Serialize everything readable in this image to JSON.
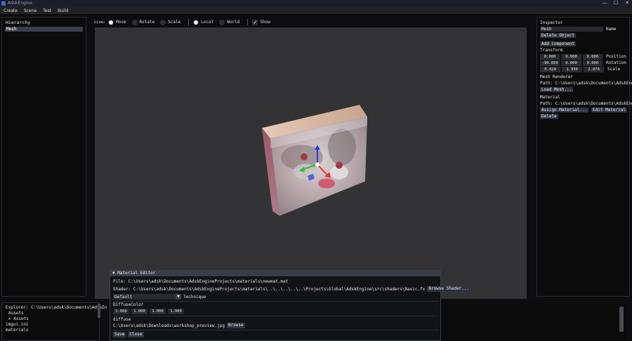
{
  "titlebar": {
    "title": "AdskEngine"
  },
  "window_controls": {
    "minimize": "—",
    "maximize": "☐",
    "close": "✕"
  },
  "menu": {
    "items": [
      "Create",
      "Scene",
      "Test",
      "Build"
    ]
  },
  "hierarchy": {
    "title": "Hierarchy",
    "items": [
      "Mesh"
    ]
  },
  "gizmo": {
    "label": "Gizmo",
    "modes": [
      "Move",
      "Rotate",
      "Scale"
    ],
    "selected_mode": "Move",
    "spaces": [
      "Local",
      "World"
    ],
    "selected_space": "Local",
    "show_label": "Show",
    "show_checked": true
  },
  "inspector": {
    "title": "Inspector",
    "name_value": "Mesh",
    "name_label": "Name",
    "delete_object": "Delete Object",
    "add_component": "Add Component",
    "transform_title": "Transform",
    "position": {
      "values": [
        "0.000",
        "0.000",
        "0.000"
      ],
      "label": "Position"
    },
    "rotation": {
      "values": [
        "-90.000",
        "0.000",
        "0.000"
      ],
      "label": "Rotation"
    },
    "scale": {
      "values": [
        "0.420",
        "1.930",
        "2.070"
      ],
      "label": "Scale"
    },
    "mesh_renderer_title": "Mesh Renderer",
    "mesh_path": "Path: C:\\Users\\adsk\\Documents\\AdskEngin",
    "load_mesh": "Load Mesh...",
    "material_title": "Material",
    "material_path": "Path: C:\\Users\\adsk\\Documents\\AdskEngi",
    "assign_material": "Assign Material...",
    "edit_material": "Edit Material",
    "delete": "Delete"
  },
  "explorer": {
    "path": "Explorer: C:\\Users\\adsk\\Documents\\AdskEn",
    "assets_header": "Assets",
    "assets_folder": "▸ Assets",
    "file1": "imgui.ini",
    "file2": "materials"
  },
  "material_editor": {
    "title": "▼ Material Editor",
    "file": "File: C:\\Users\\adsk\\Documents\\AdskEngineProjects\\materials\\newmat.mat",
    "shader": "Shader: C:\\Users\\adsk\\Documents\\AdskEngineProjects\\materials\\..\\..\\..\\..\\..\\Projects\\Global\\AdskEngine\\src\\shaders\\Basic.fx",
    "browse_shader": "Browse Shader...",
    "technique_value": "Default",
    "technique_label": "Technique",
    "diffuse_color_label": "DiffuseColor",
    "diffuse_color_values": [
      "1.000",
      "1.000",
      "1.000",
      "1.000"
    ],
    "diffuse_label": "diffuse",
    "diffuse_path": "C:\\Users\\adsk\\Downloads\\workshop_preview.jpg",
    "browse": "Browse",
    "save": "Save",
    "close": "Close"
  },
  "colors": {
    "background": "#0d0d0f",
    "viewport": "#333335",
    "selected_row": "#3b3f4a",
    "button": "#2f3440",
    "gizmo_x": "#e03030",
    "gizmo_y": "#2bbf3a",
    "gizmo_z": "#2a3ee0"
  }
}
